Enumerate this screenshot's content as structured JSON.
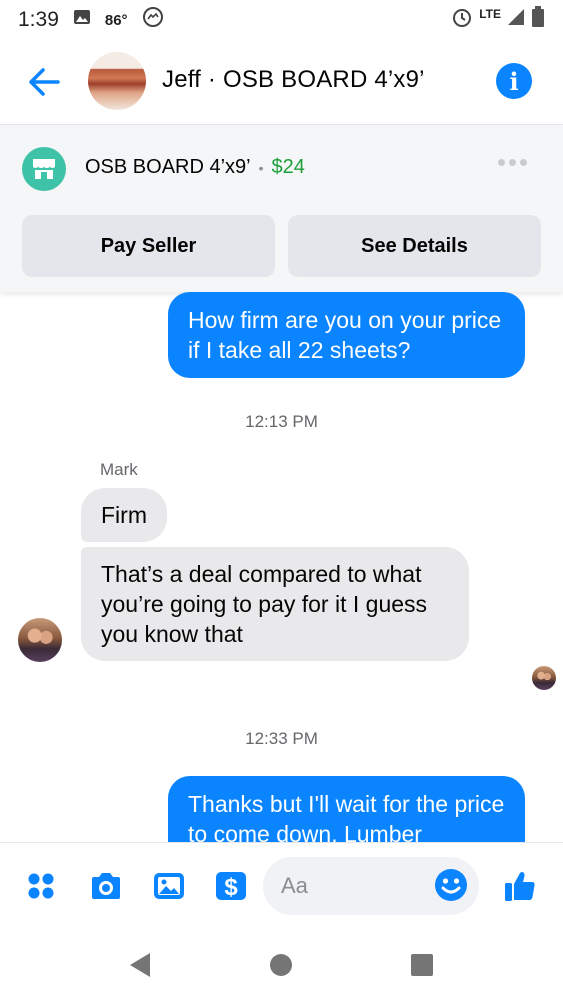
{
  "status_bar": {
    "time": "1:39",
    "temperature": "86°",
    "network": "LTE"
  },
  "header": {
    "title": "Jeff · OSB BOARD 4’x9’"
  },
  "listing": {
    "name": "OSB BOARD 4’x9’",
    "separator": "•",
    "price": "$24",
    "pay_label": "Pay Seller",
    "details_label": "See Details"
  },
  "chat": {
    "messages": [
      {
        "direction": "outgoing",
        "text": "How firm are you on your price if I take all 22 sheets?"
      },
      {
        "type": "timestamp",
        "text": "12:13 PM"
      },
      {
        "type": "sender",
        "text": "Mark"
      },
      {
        "direction": "incoming",
        "text": "Firm"
      },
      {
        "direction": "incoming",
        "text": "That’s a deal compared to what you’re going to pay for it I guess you know that"
      },
      {
        "type": "timestamp",
        "text": "12:33 PM"
      },
      {
        "direction": "outgoing",
        "text": "Thanks but I'll wait for the price to come down. Lumber"
      }
    ]
  },
  "composer": {
    "placeholder": "Aa"
  },
  "colors": {
    "accent": "#0a84ff",
    "price": "#1d9e3a",
    "marketplace": "#3ec3a8"
  }
}
